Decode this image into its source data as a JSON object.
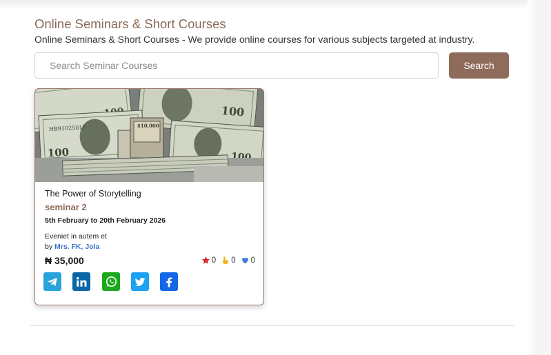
{
  "page": {
    "title": "Online Seminars & Short Courses",
    "subtitle": "Online Seminars & Short Courses - We provide online courses for various subjects targeted at industry."
  },
  "search": {
    "placeholder": "Search Seminar Courses",
    "value": "",
    "button_label": "Search"
  },
  "course": {
    "image": "money-stack-image",
    "title": "The Power of Storytelling",
    "type": "seminar 2",
    "dates": "5th February to 20th February 2026",
    "description": "Eveniet in autem et",
    "by_prefix": "by",
    "instructors": "Mrs. FK, Jola",
    "price": "₦ 35,000",
    "stats": {
      "stars": "0",
      "clicks": "0",
      "likes": "0"
    },
    "share": [
      {
        "icon": "telegram-icon",
        "color": "#2aa3dd"
      },
      {
        "icon": "linkedin-icon",
        "color": "#0a66a8"
      },
      {
        "icon": "whatsapp-icon",
        "color": "#1da81d"
      },
      {
        "icon": "twitter-icon",
        "color": "#1da1f2"
      },
      {
        "icon": "facebook-icon",
        "color": "#1467e6"
      }
    ]
  },
  "colors": {
    "brand": "#8c6a58",
    "button": "#8f6b5b",
    "link": "#3a73c9"
  }
}
